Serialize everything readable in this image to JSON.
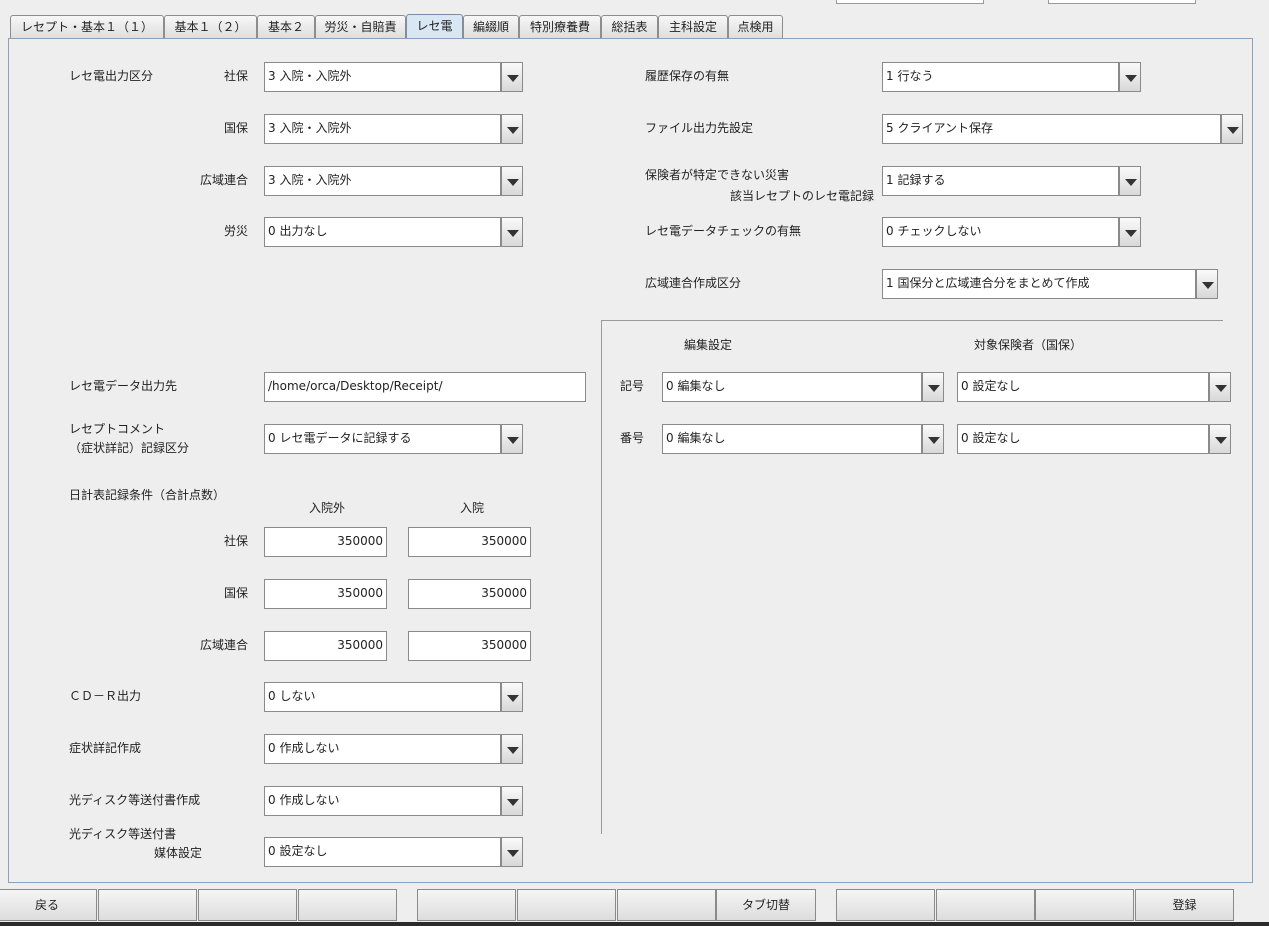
{
  "tabs": [
    {
      "label": "レセプト・基本１（１）",
      "active": false
    },
    {
      "label": "基本１（２）",
      "active": false
    },
    {
      "label": "基本２",
      "active": false
    },
    {
      "label": "労災・自賠責",
      "active": false
    },
    {
      "label": "レセ電",
      "active": true
    },
    {
      "label": "編綴順",
      "active": false
    },
    {
      "label": "特別療養費",
      "active": false
    },
    {
      "label": "総括表",
      "active": false
    },
    {
      "label": "主科設定",
      "active": false
    },
    {
      "label": "点検用",
      "active": false
    }
  ],
  "left": {
    "output_section_label": "レセ電出力区分",
    "rows": [
      {
        "label": "社保",
        "value": "3 入院・入院外"
      },
      {
        "label": "国保",
        "value": "3 入院・入院外"
      },
      {
        "label": "広域連合",
        "value": "3 入院・入院外"
      },
      {
        "label": "労災",
        "value": "0 出力なし"
      }
    ],
    "data_dest_label": "レセ電データ出力先",
    "data_dest_value": "/home/orca/Desktop/Receipt/",
    "comment_label_1": "レセプトコメント",
    "comment_label_2": "（症状詳記）記録区分",
    "comment_value": "0 レセ電データに記録する",
    "daily_label": "日計表記録条件（合計点数）",
    "col_outpatient": "入院外",
    "col_inpatient": "入院",
    "daily_rows": [
      {
        "label": "社保",
        "outpatient": "350000",
        "inpatient": "350000"
      },
      {
        "label": "国保",
        "outpatient": "350000",
        "inpatient": "350000"
      },
      {
        "label": "広域連合",
        "outpatient": "350000",
        "inpatient": "350000"
      }
    ],
    "cdr_label": "ＣＤ－Ｒ出力",
    "cdr_value": "0 しない",
    "symptom_label": "症状詳記作成",
    "symptom_value": "0 作成しない",
    "disk_doc_label": "光ディスク等送付書作成",
    "disk_doc_value": "0 作成しない",
    "disk_media_label_1": "光ディスク等送付書",
    "disk_media_label_2": "媒体設定",
    "disk_media_value": "0 設定なし"
  },
  "right": {
    "history_label": "履歴保存の有無",
    "history_value": "1 行なう",
    "file_dest_label": "ファイル出力先設定",
    "file_dest_value": "5 クライアント保存",
    "disaster_label_1": "保険者が特定できない災害",
    "disaster_label_2": "該当レセプトのレセ電記録",
    "disaster_value": "1 記録する",
    "check_label": "レセ電データチェックの有無",
    "check_value": "0 チェックしない",
    "wide_label": "広域連合作成区分",
    "wide_value": "1 国保分と広域連合分をまとめて作成",
    "edit_header": "編集設定",
    "target_header": "対象保険者（国保）",
    "edit_rows": [
      {
        "label": "記号",
        "edit": "0 編集なし",
        "target": "0 設定なし"
      },
      {
        "label": "番号",
        "edit": "0 編集なし",
        "target": "0 設定なし"
      }
    ]
  },
  "footer": {
    "buttons": [
      "戻る",
      "",
      "",
      "",
      "",
      "",
      "",
      "タブ切替",
      "",
      "",
      "",
      "登録"
    ]
  }
}
